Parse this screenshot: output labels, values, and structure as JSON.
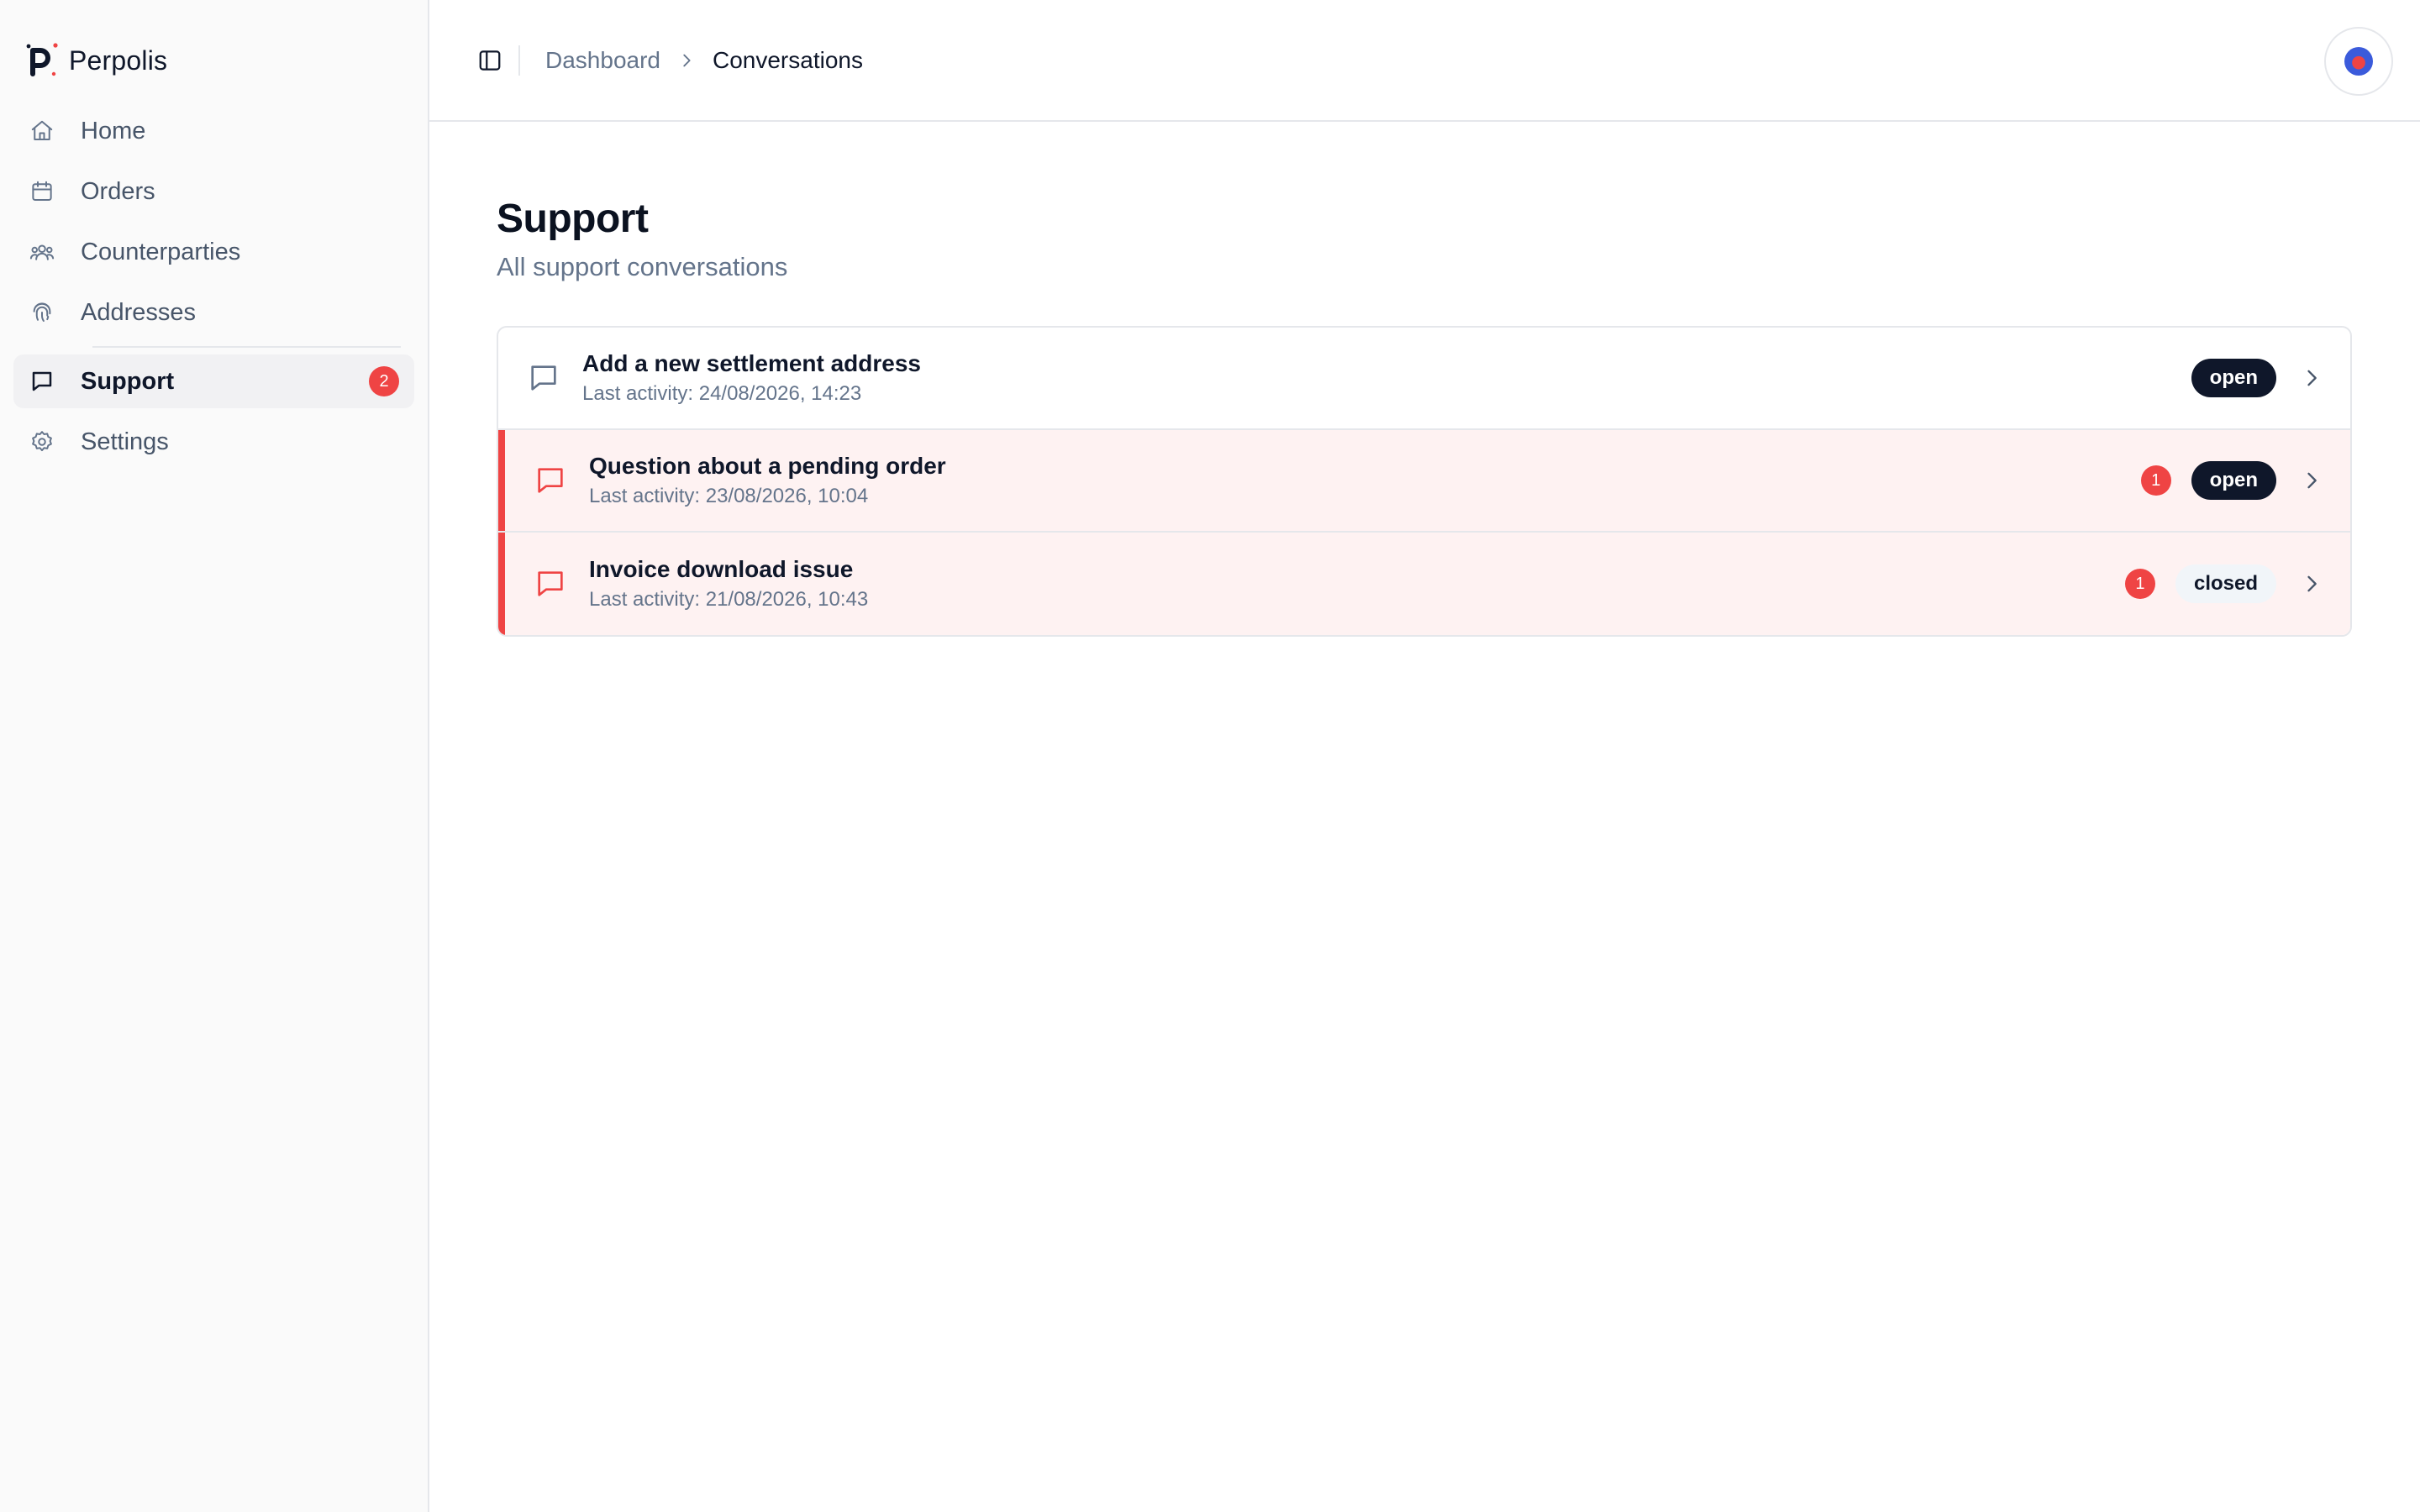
{
  "brand": {
    "name": "Perpolis"
  },
  "sidebar": {
    "items": [
      {
        "label": "Home",
        "icon": "home-icon"
      },
      {
        "label": "Orders",
        "icon": "calendar-icon"
      },
      {
        "label": "Counterparties",
        "icon": "users-icon"
      },
      {
        "label": "Addresses",
        "icon": "fingerprint-icon"
      },
      {
        "label": "Support",
        "icon": "message-icon",
        "badge": "2",
        "active": true
      },
      {
        "label": "Settings",
        "icon": "gear-icon"
      }
    ]
  },
  "breadcrumb": {
    "parent": "Dashboard",
    "current": "Conversations"
  },
  "page": {
    "title": "Support",
    "subtitle": "All support conversations"
  },
  "conversations": [
    {
      "title": "Add a new settlement address",
      "meta": "Last activity: 24/08/2026, 14:23",
      "unread": "",
      "status": "open"
    },
    {
      "title": "Question about a pending order",
      "meta": "Last activity: 23/08/2026, 10:04",
      "unread": "1",
      "status": "open"
    },
    {
      "title": "Invoice download issue",
      "meta": "Last activity: 21/08/2026, 10:43",
      "unread": "1",
      "status": "closed"
    }
  ],
  "colors": {
    "accent": "#ef4444",
    "primary": "#0f172a",
    "muted": "#64748b",
    "unread_row_bg": "#fef2f2"
  }
}
